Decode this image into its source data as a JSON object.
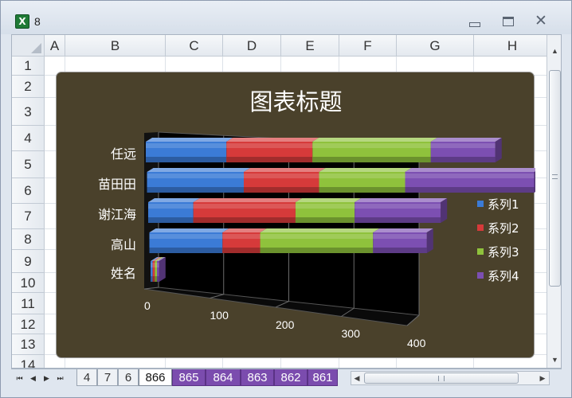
{
  "window": {
    "title": "8",
    "app_icon": "excel-icon"
  },
  "columns": [
    "A",
    "B",
    "C",
    "D",
    "E",
    "F",
    "G",
    "H"
  ],
  "rows": [
    "1",
    "2",
    "3",
    "4",
    "5",
    "6",
    "7",
    "8",
    "9",
    "10",
    "11",
    "12",
    "13",
    "14"
  ],
  "sheet_tabs": [
    {
      "label": "4",
      "style": "normal"
    },
    {
      "label": "7",
      "style": "normal"
    },
    {
      "label": "6",
      "style": "normal"
    },
    {
      "label": "866",
      "style": "active"
    },
    {
      "label": "865",
      "style": "colored"
    },
    {
      "label": "864",
      "style": "colored"
    },
    {
      "label": "863",
      "style": "colored"
    },
    {
      "label": "862",
      "style": "colored"
    },
    {
      "label": "861",
      "style": "colored"
    }
  ],
  "chart_data": {
    "type": "bar",
    "orientation": "horizontal",
    "stacked": true,
    "three_d": true,
    "title": "图表标题",
    "categories": [
      "任远",
      "苗田田",
      "谢江海",
      "高山",
      "姓名"
    ],
    "series": [
      {
        "name": "系列1",
        "color": "#3b7bd6",
        "values": [
          75,
          90,
          42,
          68,
          2
        ]
      },
      {
        "name": "系列2",
        "color": "#d63a3a",
        "values": [
          80,
          70,
          95,
          35,
          2
        ]
      },
      {
        "name": "系列3",
        "color": "#8fc23c",
        "values": [
          110,
          80,
          55,
          105,
          2
        ]
      },
      {
        "name": "系列4",
        "color": "#7c4fb2",
        "values": [
          60,
          120,
          80,
          50,
          2
        ]
      }
    ],
    "xaxis": {
      "ticks": [
        "0",
        "100",
        "200",
        "300",
        "400"
      ],
      "min": 0,
      "max": 400
    },
    "grid": true,
    "legend_position": "right",
    "plot_background": "#000000",
    "chart_background": "#4a412b"
  }
}
